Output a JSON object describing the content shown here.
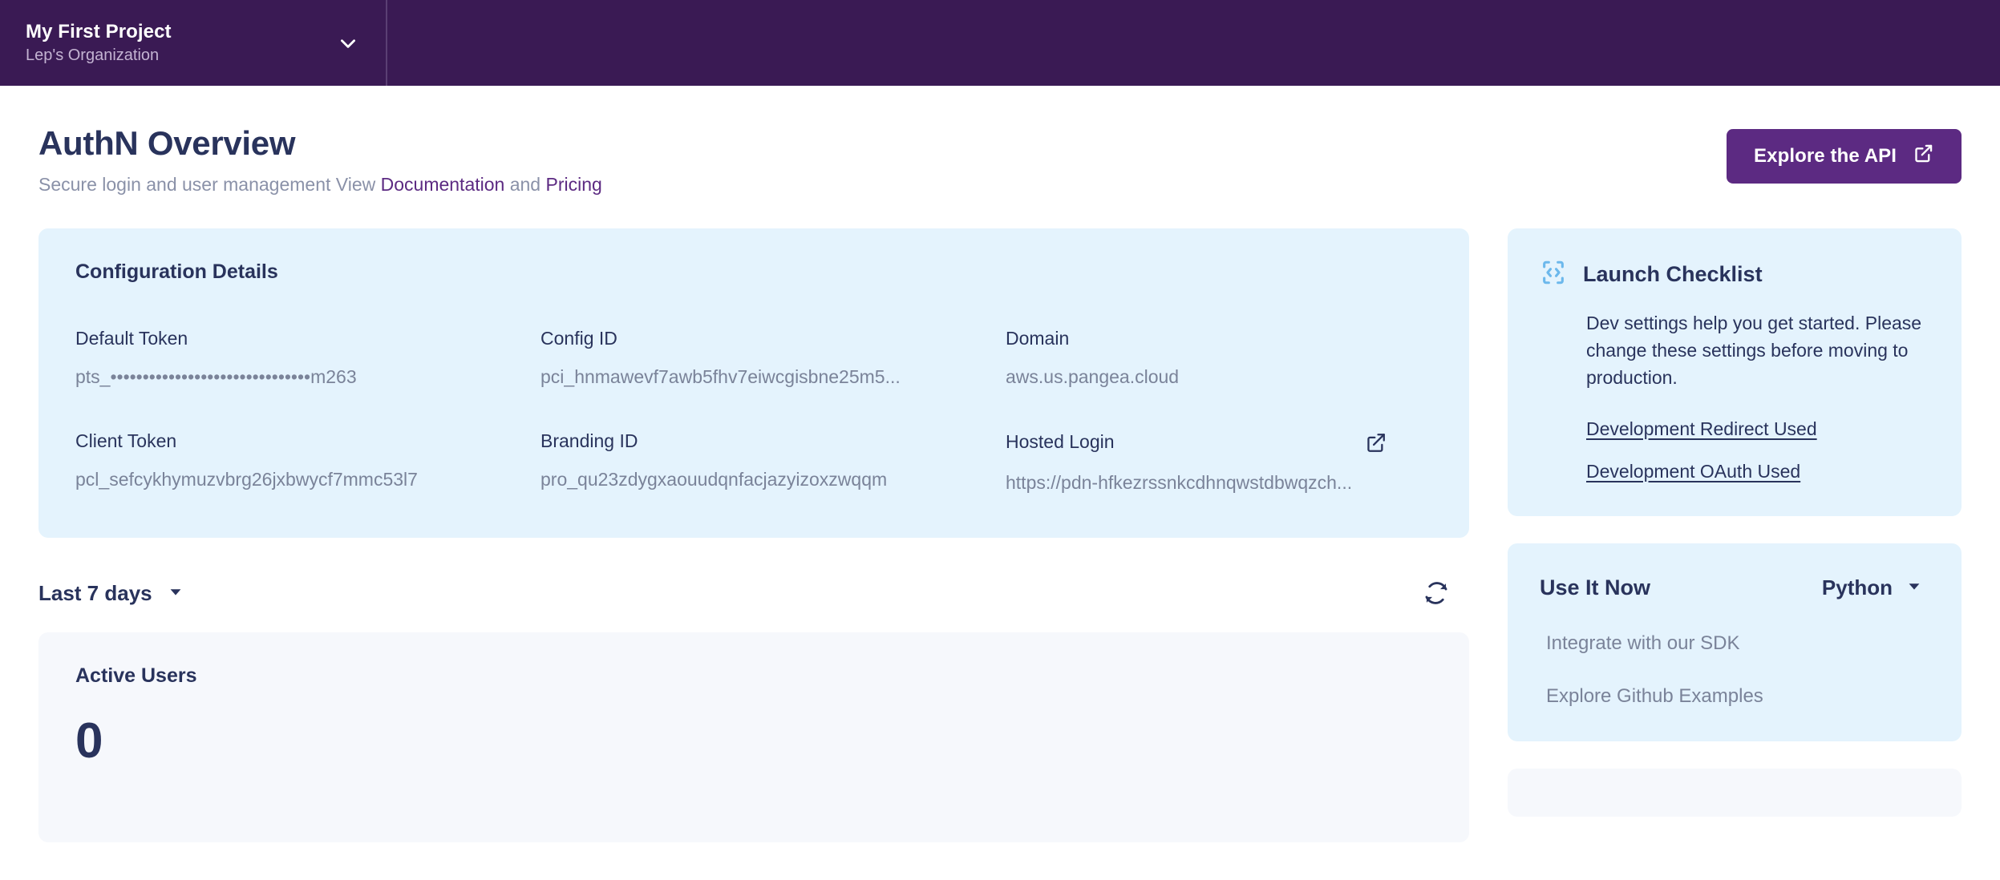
{
  "topbar": {
    "project_name": "My First Project",
    "organization": "Lep's Organization",
    "chevron_icon": "chevron-down-icon"
  },
  "header": {
    "title": "AuthN Overview",
    "subtitle_prefix": "Secure login and user management View",
    "doc_link": "Documentation",
    "subtitle_mid": "and",
    "pricing_link": "Pricing",
    "explore_button": "Explore the API",
    "explore_icon": "external-link-icon"
  },
  "configuration": {
    "heading": "Configuration Details",
    "fields": [
      {
        "label": "Default Token",
        "value": "pts_•••••••••••••••••••••••••••••••m263"
      },
      {
        "label": "Config ID",
        "value": "pci_hnmawevf7awb5fhv7eiwcgisbne25m5..."
      },
      {
        "label": "Domain",
        "value": "aws.us.pangea.cloud"
      },
      {
        "label": "Client Token",
        "value": "pcl_sefcykhymuzvbrg26jxbwycf7mmc53l7"
      },
      {
        "label": "Branding ID",
        "value": "pro_qu23zdygxaouudqnfacjazyizoxzwqqm"
      },
      {
        "label": "Hosted Login",
        "value": "https://pdn-hfkezrssnkcdhnqwstdbwqzch...",
        "action_icon": "external-link-icon"
      }
    ]
  },
  "range": {
    "selected": "Last 7 days",
    "chevron_icon": "chevron-down-icon",
    "refresh_icon": "refresh-icon"
  },
  "metric": {
    "title": "Active Users",
    "value": "0"
  },
  "launch_checklist": {
    "icon": "code-brackets-icon",
    "title": "Launch Checklist",
    "body": "Dev settings help you get started. Please change these settings before moving to production.",
    "links": [
      "Development Redirect Used",
      "Development OAuth Used"
    ]
  },
  "use_it_now": {
    "title": "Use It Now",
    "language": "Python",
    "chevron_icon": "chevron-down-icon",
    "items": [
      "Integrate with our SDK",
      "Explore Github Examples"
    ]
  },
  "colors": {
    "topbar": "#3a1a54",
    "accent": "#5c2a82",
    "card_blue": "#e4f3fd",
    "card_grey": "#f6f8fc",
    "text_dark": "#29335c",
    "text_muted": "#7a8399",
    "icon_blue": "#6cb8ec"
  }
}
